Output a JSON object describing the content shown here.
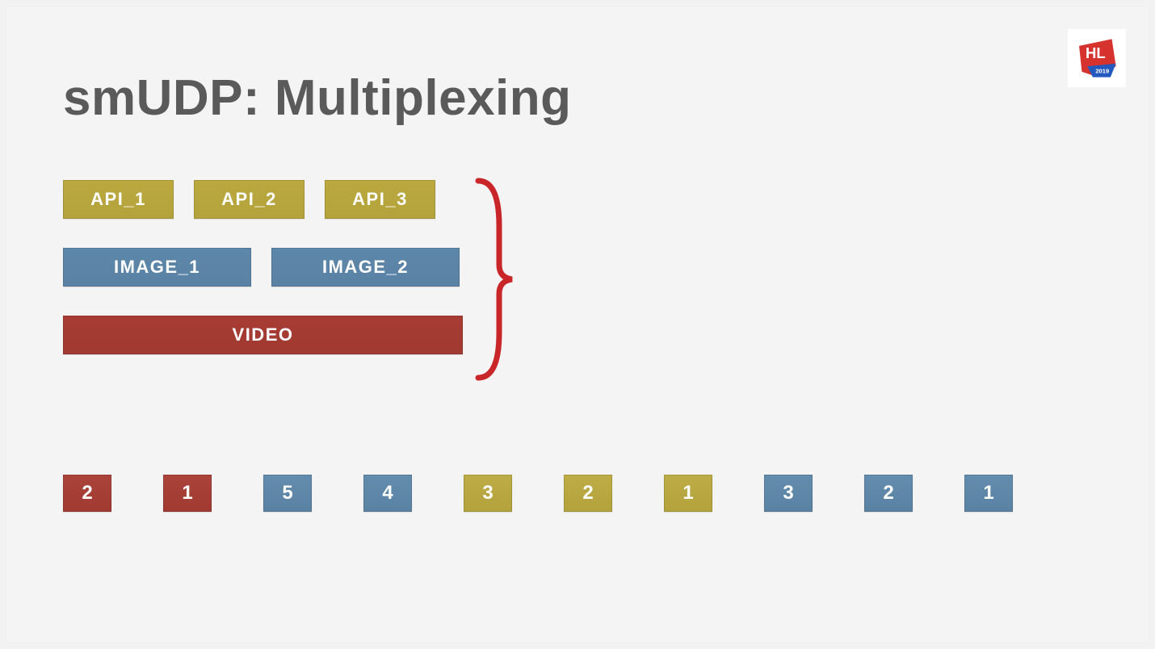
{
  "title": "smUDP: Multiplexing",
  "logo": {
    "text": "HL",
    "sub": "2019"
  },
  "colors": {
    "olive": "#bba93f",
    "blue": "#5d87aa",
    "red": "#a73c33",
    "brace": "#c9262a",
    "title": "#5a5a5a"
  },
  "streams": {
    "apis": [
      "API_1",
      "API_2",
      "API_3"
    ],
    "images": [
      "IMAGE_1",
      "IMAGE_2"
    ],
    "video": "VIDEO"
  },
  "packets": [
    {
      "n": "2",
      "color": "red"
    },
    {
      "n": "1",
      "color": "red"
    },
    {
      "n": "5",
      "color": "blue"
    },
    {
      "n": "4",
      "color": "blue"
    },
    {
      "n": "3",
      "color": "olive"
    },
    {
      "n": "2",
      "color": "olive"
    },
    {
      "n": "1",
      "color": "olive"
    },
    {
      "n": "3",
      "color": "blue"
    },
    {
      "n": "2",
      "color": "blue"
    },
    {
      "n": "1",
      "color": "blue"
    }
  ]
}
